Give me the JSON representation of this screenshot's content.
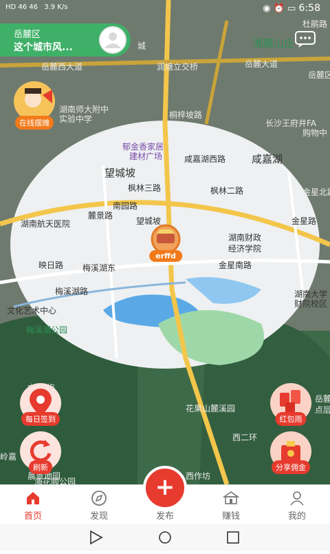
{
  "statusbar": {
    "left": "HD 46 46",
    "speed": "3.9 K/s",
    "time": "6:58"
  },
  "location": {
    "district": "岳麓区",
    "city_label": "这个城市风..."
  },
  "map": {
    "labels": [
      "岳麓西大道",
      "润塘立交桥",
      "岳麓大道",
      "湘麓山庄",
      "杜鹃路",
      "岳麓区",
      "城",
      "湖南师大附中",
      "实验中学",
      "桐梓坡路",
      "长沙王府井FA",
      "购物中",
      "郁金香家居",
      "建材广场",
      "咸嘉湖西路",
      "咸嘉湖",
      "望城坡",
      "枫林三路",
      "枫林二路",
      "金星北路",
      "湖南航天医院",
      "麓景路",
      "南园路",
      "望城坡",
      "金星路",
      "湖南财政",
      "经济学院",
      "映日路",
      "梅溪湖东",
      "金星南路",
      "梅溪湖路",
      "文化艺术中心",
      "湖南大学",
      "财院校区",
      "梅溪湖公园",
      "中海 梅",
      "花果山麓溪园",
      "西二环",
      "岳麓",
      "点层",
      "岭嘉",
      "晨景地园",
      "海花顺公园",
      "西作坊"
    ],
    "marker_label": "erffd"
  },
  "float_buttons": {
    "stall": "在线摆摊",
    "checkin": "每日签到",
    "refresh": "刷新",
    "redpacket": "红包雨",
    "share": "分享佣金"
  },
  "tabs": [
    {
      "label": "首页",
      "icon": "home-icon"
    },
    {
      "label": "发现",
      "icon": "compass-icon"
    },
    {
      "label": "发布",
      "icon": "plus-icon"
    },
    {
      "label": "赚钱",
      "icon": "bank-icon"
    },
    {
      "label": "我的",
      "icon": "user-icon"
    }
  ],
  "publish_symbol": "+",
  "colors": {
    "accent": "#e63b2e",
    "location_bar": "#3fb068",
    "map_dark": "#6f7a6e"
  }
}
